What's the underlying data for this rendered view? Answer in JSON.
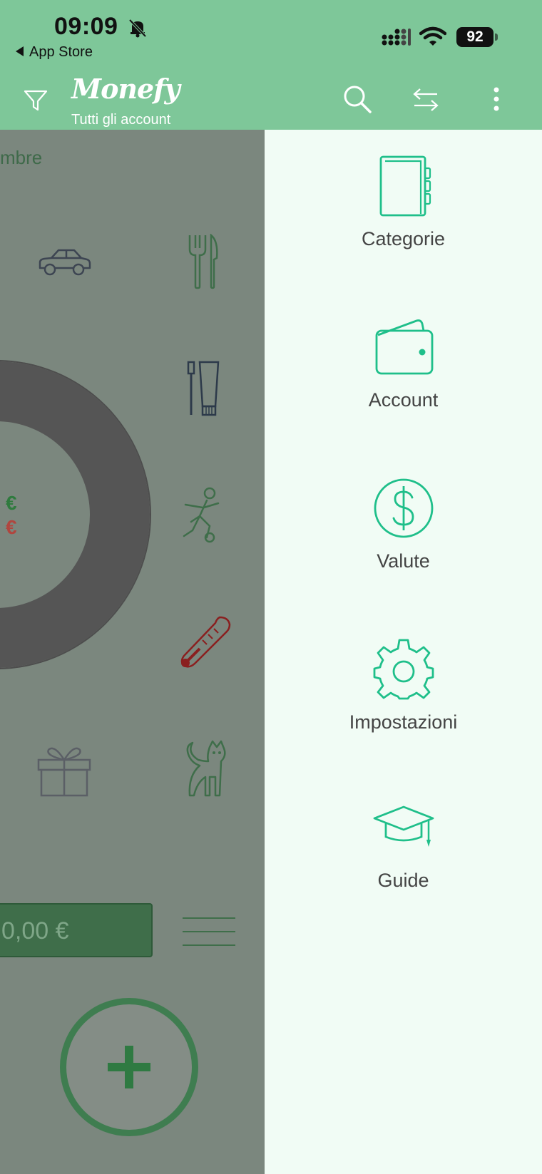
{
  "status_bar": {
    "time": "09:09",
    "back_label": "App Store",
    "battery": "92"
  },
  "header": {
    "logo": "Monefy",
    "subtitle": "Tutti gli account"
  },
  "main": {
    "month_partial": "mbre",
    "balance_partial": "0,00 €",
    "income_symbol": "€",
    "expense_symbol": "€"
  },
  "drawer": {
    "items": [
      {
        "label": "Categorie",
        "icon": "notebook-icon"
      },
      {
        "label": "Account",
        "icon": "wallet-icon"
      },
      {
        "label": "Valute",
        "icon": "dollar-icon"
      },
      {
        "label": "Impostazioni",
        "icon": "gear-icon"
      },
      {
        "label": "Guide",
        "icon": "graduation-cap-icon"
      }
    ]
  },
  "colors": {
    "header": "#7ec799",
    "accent": "#1fbf8a",
    "drawer_bg": "#f1fcf5",
    "overlay": "#7b877e"
  }
}
